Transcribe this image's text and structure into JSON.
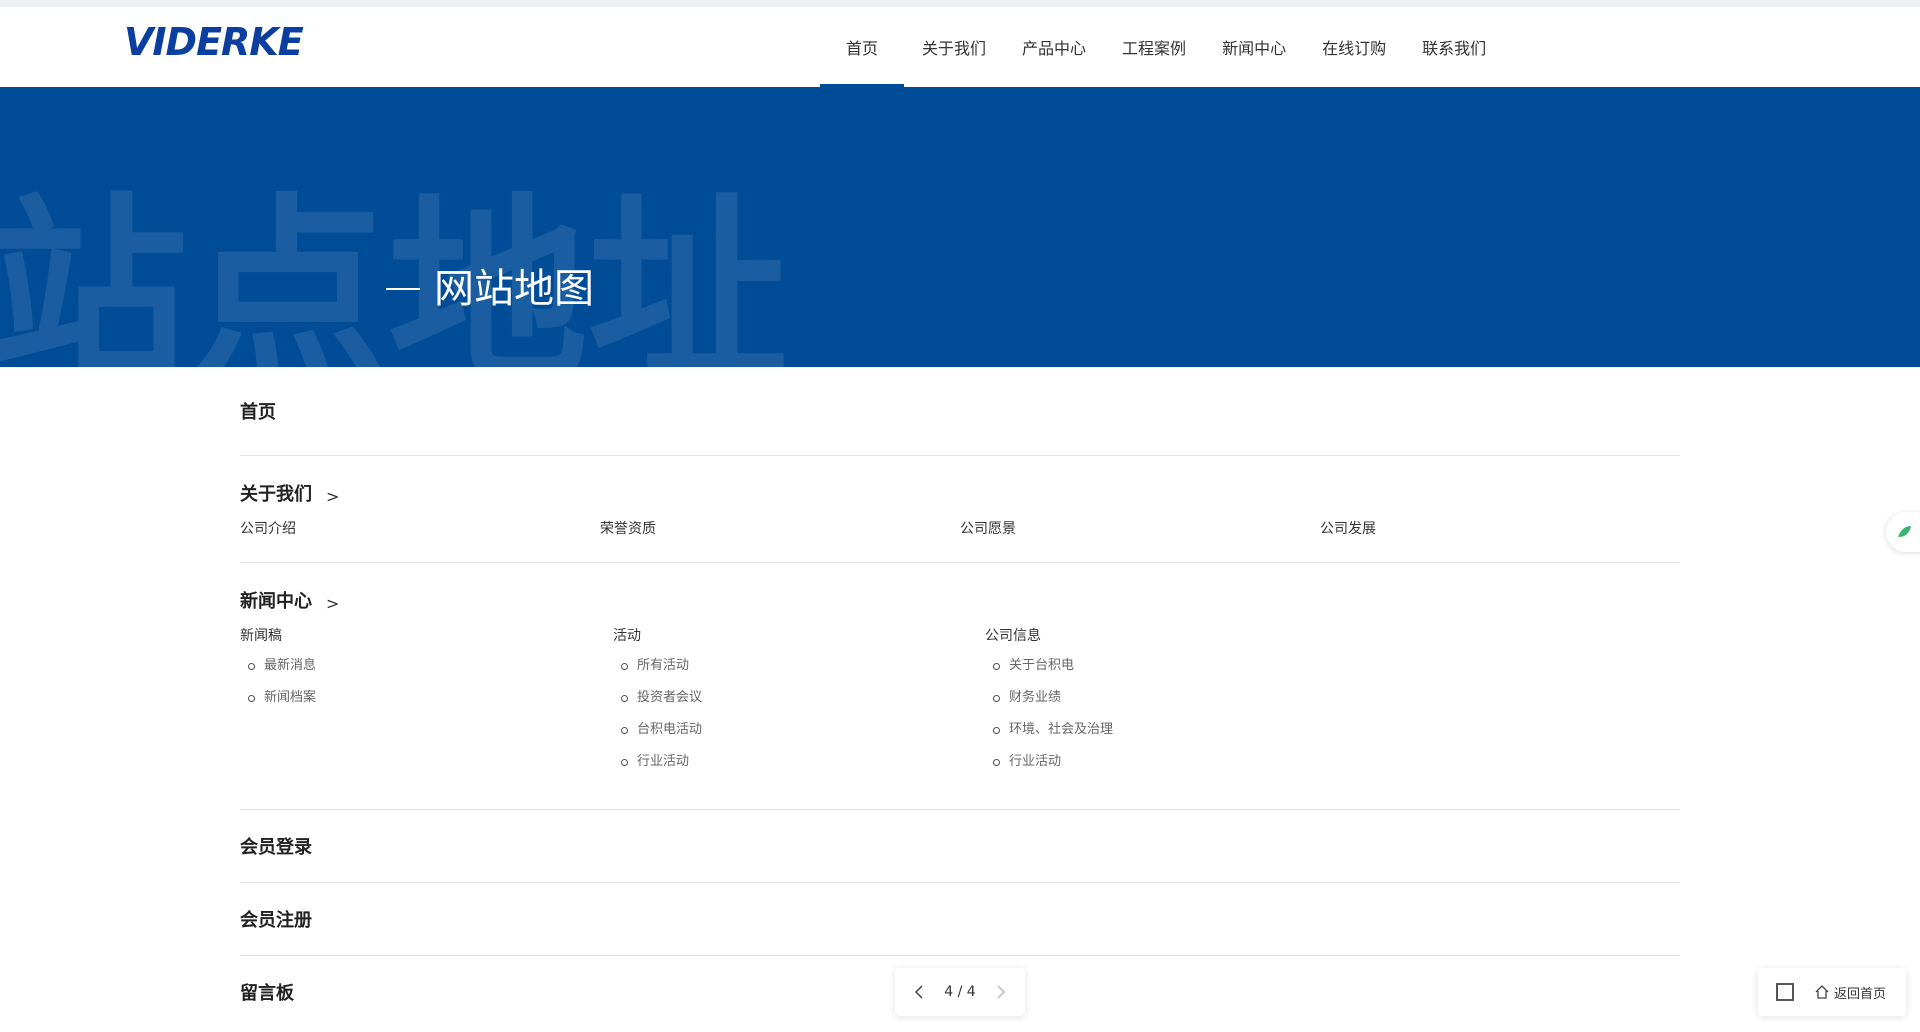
{
  "header": {
    "logo_text": "VIDERKE",
    "nav": [
      "首页",
      "关于我们",
      "产品中心",
      "工程案例",
      "新闻中心",
      "在线订购",
      "联系我们"
    ],
    "active_index": 0
  },
  "banner": {
    "watermark": "站点地址",
    "title": "网站地图"
  },
  "sitemap": {
    "home": "首页",
    "about": {
      "title": "关于我们",
      "arrow": ">",
      "links": [
        "公司介绍",
        "荣誉资质",
        "公司愿景",
        "公司发展"
      ]
    },
    "news": {
      "title": "新闻中心",
      "arrow": ">",
      "columns": [
        {
          "title": "新闻稿",
          "items": [
            "最新消息",
            "新闻档案"
          ]
        },
        {
          "title": "活动",
          "items": [
            "所有活动",
            "投资者会议",
            "台积电活动",
            "行业活动"
          ]
        },
        {
          "title": "公司信息",
          "items": [
            "关于台积电",
            "财务业绩",
            "环境、社会及治理",
            "行业活动"
          ]
        }
      ]
    },
    "login": "会员登录",
    "register": "会员注册",
    "guestbook": "留言板"
  },
  "pager": {
    "text": "4 / 4"
  },
  "toolbar": {
    "home_label": "返回首页"
  },
  "colors": {
    "brand": "#004c97",
    "accent": "#0a3fa0"
  }
}
